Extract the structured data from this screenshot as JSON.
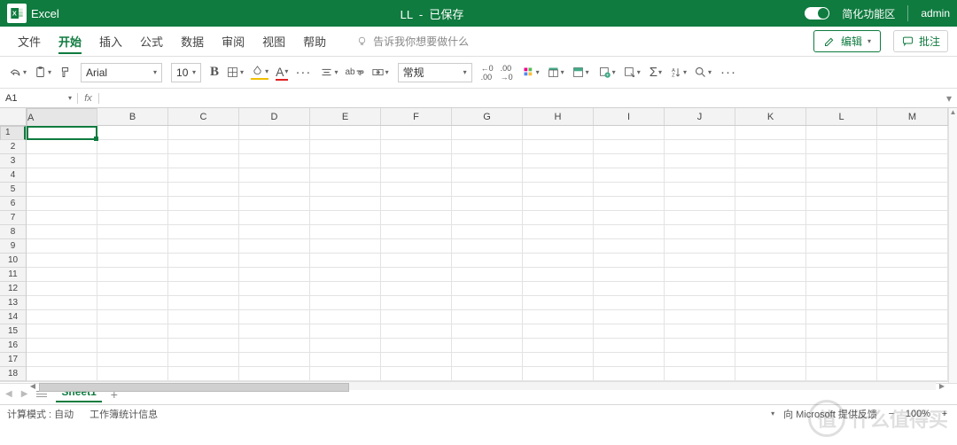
{
  "colors": {
    "brand": "#0f7b3f"
  },
  "title": {
    "app": "Excel",
    "doc": "LL",
    "status": "已保存",
    "simplify": "简化功能区",
    "user": "admin"
  },
  "menu": {
    "items": [
      "文件",
      "开始",
      "插入",
      "公式",
      "数据",
      "审阅",
      "视图",
      "帮助"
    ],
    "active_index": 1,
    "tell_me": "告诉我你想要做什么",
    "edit": "编辑",
    "comments": "批注"
  },
  "toolbar": {
    "font": "Arial",
    "size": "10",
    "bold": "B",
    "fill_letter": "A",
    "font_letter": "A",
    "wrap": "ab",
    "number_format": "常规",
    "dec_inc": ".00",
    "dec_dec": ".00"
  },
  "formula": {
    "cell_ref": "A1",
    "fx": "fx",
    "value": ""
  },
  "grid": {
    "columns": [
      "A",
      "B",
      "C",
      "D",
      "E",
      "F",
      "G",
      "H",
      "I",
      "J",
      "K",
      "L",
      "M"
    ],
    "rows": [
      1,
      2,
      3,
      4,
      5,
      6,
      7,
      8,
      9,
      10,
      11,
      12,
      13,
      14,
      15,
      16,
      17,
      18
    ],
    "active": "A1"
  },
  "sheets": {
    "active": "Sheet1"
  },
  "status": {
    "calc": "计算模式 : 自动",
    "stats": "工作簿统计信息",
    "feedback": "向 Microsoft 提供反馈",
    "zoom": "100%"
  },
  "watermark": {
    "char": "值",
    "text": "什么值得买"
  }
}
